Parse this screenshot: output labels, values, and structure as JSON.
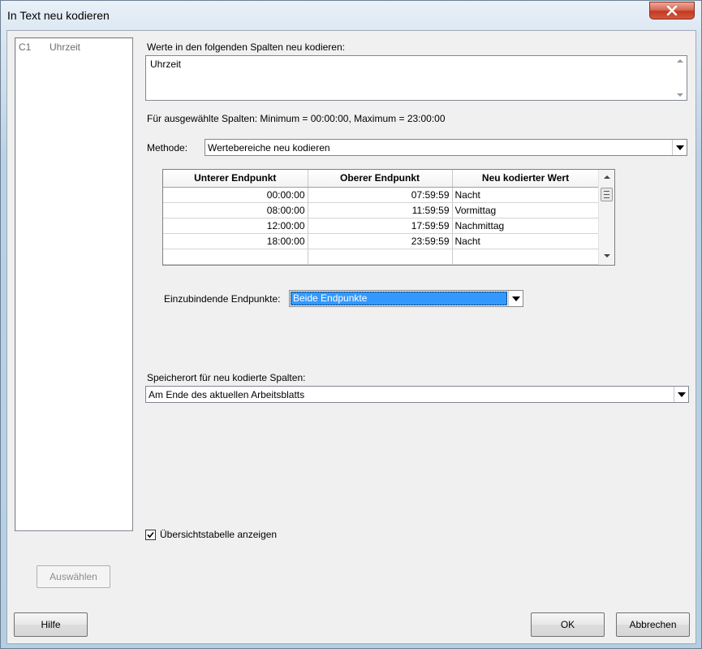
{
  "window": {
    "title": "In Text neu kodieren"
  },
  "columns_list": [
    {
      "id": "C1",
      "name": "Uhrzeit"
    }
  ],
  "recode_columns": {
    "label": "Werte in den folgenden Spalten neu kodieren:",
    "value": "Uhrzeit"
  },
  "selected_info": "Für ausgewählte Spalten: Minimum = 00:00:00, Maximum = 23:00:00",
  "method": {
    "label": "Methode:",
    "value": "Wertebereiche neu kodieren"
  },
  "table": {
    "headers": [
      "Unterer Endpunkt",
      "Oberer Endpunkt",
      "Neu kodierter Wert"
    ],
    "rows": [
      [
        "00:00:00",
        "07:59:59",
        "Nacht"
      ],
      [
        "08:00:00",
        "11:59:59",
        "Vormittag"
      ],
      [
        "12:00:00",
        "17:59:59",
        "Nachmittag"
      ],
      [
        "18:00:00",
        "23:59:59",
        "Nacht"
      ],
      [
        "",
        "",
        ""
      ]
    ]
  },
  "endpoints": {
    "label": "Einzubindende Endpunkte:",
    "value": "Beide Endpunkte"
  },
  "storage": {
    "label": "Speicherort für neu kodierte Spalten:",
    "value": "Am Ende des aktuellen Arbeitsblatts"
  },
  "summary_table": {
    "label": "Übersichtstabelle anzeigen",
    "checked": true
  },
  "buttons": {
    "select": "Auswählen",
    "help": "Hilfe",
    "ok": "OK",
    "cancel": "Abbrechen"
  }
}
